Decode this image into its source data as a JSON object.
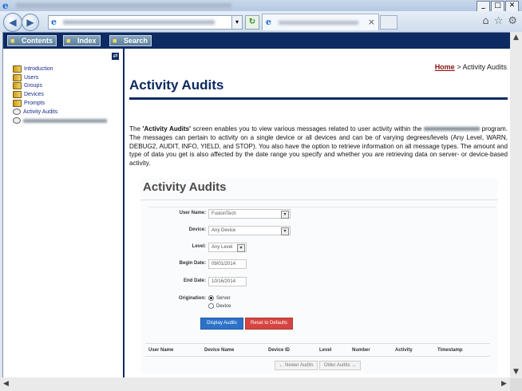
{
  "window": {
    "logo_glyph": "e",
    "minimize": "_",
    "maximize": "□",
    "close": "✕"
  },
  "nav": {
    "back_glyph": "◀",
    "forward_glyph": "▶",
    "dropdown_glyph": "▾",
    "refresh_glyph": "↻",
    "tab_close": "×",
    "home_glyph": "⌂",
    "favorites_glyph": "☆",
    "tools_glyph": "⚙"
  },
  "helpbar": {
    "contents": "Contents",
    "index": "Index",
    "search": "Search"
  },
  "toc": {
    "items": [
      "Introduction",
      "Users",
      "Groups",
      "Devices",
      "Prompts",
      "Activity Audits"
    ]
  },
  "page": {
    "breadcrumb_home": "Home",
    "breadcrumb_sep": " > ",
    "breadcrumb_current": "Activity Audits",
    "heading": "Activity Audits",
    "para_part1": "The ",
    "para_bold": "'Activity Audits'",
    "para_part2": " screen enables you to view various messages related to user activity within the ",
    "para_part3": " program. The messages can pertain to activity on a single device or all devices and can be of varying degrees/levels (Any Level, WARN, DEBUG2, AUDIT, INFO, YIELD, and STOP). You also have the option to retrieve information on all message types. The amount and type of data you get is also affected by the date range you specify and whether you are retrieving data on server- or device-based activity."
  },
  "shot": {
    "title": "Activity Audits",
    "user_name_label": "User Name:",
    "user_name_value": "FusionTech",
    "device_label": "Device:",
    "device_value": "Any Device",
    "level_label": "Level:",
    "level_value": "Any Level",
    "begin_label": "Begin Date:",
    "begin_value": "09/01/2014",
    "end_label": "End Date:",
    "end_value": "10/16/2014",
    "origination_label": "Origination:",
    "origin_server": "Server",
    "origin_device": "Device",
    "display_btn": "Display Audits",
    "reset_btn": "Reset to Defaults",
    "columns": [
      "User Name",
      "Device Name",
      "Device ID",
      "Level",
      "Number",
      "Activity",
      "Timestamp"
    ],
    "newer_btn": "← Newer Audits",
    "older_btn": "Older Audits →"
  },
  "scroll": {
    "up": "▲",
    "down": "▼",
    "left": "◀",
    "right": "▶"
  }
}
